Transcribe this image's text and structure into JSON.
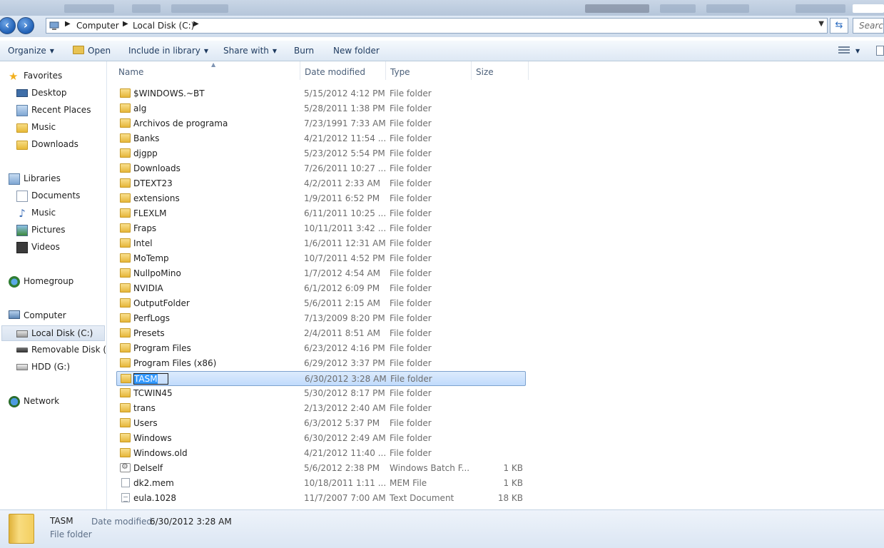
{
  "address": {
    "crumbs": [
      "Computer",
      "Local Disk (C:)"
    ],
    "search_placeholder": "Search"
  },
  "toolbar": {
    "organize": "Organize",
    "open": "Open",
    "include_in_library": "Include in library",
    "share_with": "Share with",
    "burn": "Burn",
    "new_folder": "New folder"
  },
  "nav": {
    "favorites": "Favorites",
    "desktop": "Desktop",
    "recent_places": "Recent Places",
    "music_fav": "Music",
    "downloads": "Downloads",
    "libraries": "Libraries",
    "documents": "Documents",
    "music": "Music",
    "pictures": "Pictures",
    "videos": "Videos",
    "homegroup": "Homegroup",
    "computer": "Computer",
    "local_disk": "Local Disk (C:)",
    "removable": "Removable Disk (E:",
    "hdd": "HDD (G:)",
    "network": "Network"
  },
  "columns": {
    "name": "Name",
    "date_modified": "Date modified",
    "type": "Type",
    "size": "Size"
  },
  "files": [
    {
      "name": "$WINDOWS.~BT",
      "date": "5/15/2012 4:12 PM",
      "type": "File folder",
      "size": "",
      "icon": "folder"
    },
    {
      "name": "alg",
      "date": "5/28/2011 1:38 PM",
      "type": "File folder",
      "size": "",
      "icon": "folder"
    },
    {
      "name": "Archivos de programa",
      "date": "7/23/1991 7:33 AM",
      "type": "File folder",
      "size": "",
      "icon": "folder"
    },
    {
      "name": "Banks",
      "date": "4/21/2012 11:54 ...",
      "type": "File folder",
      "size": "",
      "icon": "folder"
    },
    {
      "name": "djgpp",
      "date": "5/23/2012 5:54 PM",
      "type": "File folder",
      "size": "",
      "icon": "folder"
    },
    {
      "name": "Downloads",
      "date": "7/26/2011 10:27 ...",
      "type": "File folder",
      "size": "",
      "icon": "folder"
    },
    {
      "name": "DTEXT23",
      "date": "4/2/2011 2:33 AM",
      "type": "File folder",
      "size": "",
      "icon": "folder"
    },
    {
      "name": "extensions",
      "date": "1/9/2011 6:52 PM",
      "type": "File folder",
      "size": "",
      "icon": "folder"
    },
    {
      "name": "FLEXLM",
      "date": "6/11/2011 10:25 ...",
      "type": "File folder",
      "size": "",
      "icon": "folder"
    },
    {
      "name": "Fraps",
      "date": "10/11/2011 3:42 ...",
      "type": "File folder",
      "size": "",
      "icon": "folder"
    },
    {
      "name": "Intel",
      "date": "1/6/2011 12:31 AM",
      "type": "File folder",
      "size": "",
      "icon": "folder"
    },
    {
      "name": "MoTemp",
      "date": "10/7/2011 4:52 PM",
      "type": "File folder",
      "size": "",
      "icon": "folder"
    },
    {
      "name": "NullpoMino",
      "date": "1/7/2012 4:54 AM",
      "type": "File folder",
      "size": "",
      "icon": "folder"
    },
    {
      "name": "NVIDIA",
      "date": "6/1/2012 6:09 PM",
      "type": "File folder",
      "size": "",
      "icon": "folder"
    },
    {
      "name": "OutputFolder",
      "date": "5/6/2011 2:15 AM",
      "type": "File folder",
      "size": "",
      "icon": "folder"
    },
    {
      "name": "PerfLogs",
      "date": "7/13/2009 8:20 PM",
      "type": "File folder",
      "size": "",
      "icon": "folder"
    },
    {
      "name": "Presets",
      "date": "2/4/2011 8:51 AM",
      "type": "File folder",
      "size": "",
      "icon": "folder"
    },
    {
      "name": "Program Files",
      "date": "6/23/2012 4:16 PM",
      "type": "File folder",
      "size": "",
      "icon": "folder"
    },
    {
      "name": "Program Files (x86)",
      "date": "6/29/2012 3:37 PM",
      "type": "File folder",
      "size": "",
      "icon": "folder"
    },
    {
      "name": "TASM",
      "date": "6/30/2012 3:28 AM",
      "type": "File folder",
      "size": "",
      "icon": "folder",
      "selected": true
    },
    {
      "name": "TCWIN45",
      "date": "5/30/2012 8:17 PM",
      "type": "File folder",
      "size": "",
      "icon": "folder"
    },
    {
      "name": "trans",
      "date": "2/13/2012 2:40 AM",
      "type": "File folder",
      "size": "",
      "icon": "folder"
    },
    {
      "name": "Users",
      "date": "6/3/2012 5:37 PM",
      "type": "File folder",
      "size": "",
      "icon": "folder"
    },
    {
      "name": "Windows",
      "date": "6/30/2012 2:49 AM",
      "type": "File folder",
      "size": "",
      "icon": "folder"
    },
    {
      "name": "Windows.old",
      "date": "4/21/2012 11:40 ...",
      "type": "File folder",
      "size": "",
      "icon": "folder"
    },
    {
      "name": "Delself",
      "date": "5/6/2012 2:38 PM",
      "type": "Windows Batch F...",
      "size": "1 KB",
      "icon": "bat"
    },
    {
      "name": "dk2.mem",
      "date": "10/18/2011 1:11 ...",
      "type": "MEM File",
      "size": "1 KB",
      "icon": "file"
    },
    {
      "name": "eula.1028",
      "date": "11/7/2007 7:00 AM",
      "type": "Text Document",
      "size": "18 KB",
      "icon": "txt"
    }
  ],
  "details": {
    "name": "TASM",
    "type": "File folder",
    "date_label": "Date modified:",
    "date_value": "6/30/2012 3:28 AM"
  }
}
